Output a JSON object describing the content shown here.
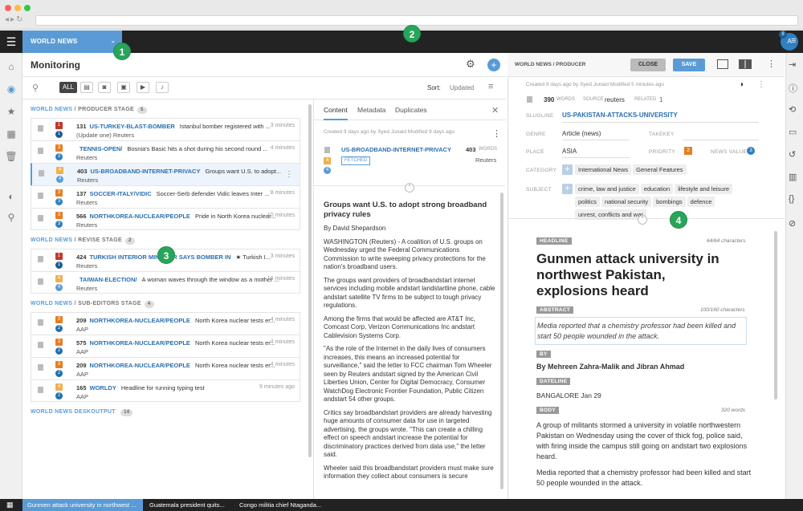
{
  "desk": {
    "name": "WORLD NEWS",
    "chevron": "⌄"
  },
  "user": {
    "initial": "A",
    "badge": "8"
  },
  "callouts": [
    "1",
    "2",
    "3",
    "4"
  ],
  "monitoring": {
    "title": "Monitoring",
    "filters": {
      "all": "ALL"
    },
    "sort_label": "Sort:",
    "sort_value": "Updated"
  },
  "groups": [
    {
      "desk": "WORLD NEWS",
      "stage": "/ PRODUCER",
      "suffix": "STAGE",
      "count": "5",
      "items": [
        {
          "urgency": "1",
          "priority": "1",
          "words": "131",
          "slug": "US-TURKEY-BLAST-BOMBER",
          "headline": "Istanbul bomber registered with ...",
          "line2": "(Update one)",
          "source": "Reuters",
          "time": "3 minutes",
          "ucolor": "#c0392b",
          "pcolor": "#1b5d95"
        },
        {
          "urgency": "3",
          "priority": "3",
          "words": "",
          "slug": "TENNIS-OPEN/",
          "headline": "Bosnia's Basic hits a shot during his second round ...",
          "line2": "",
          "source": "Reuters",
          "time": "4 minutes",
          "ucolor": "#e67e22",
          "pcolor": "#2f7fc1"
        },
        {
          "urgency": "4",
          "priority": "4",
          "words": "403",
          "slug": "US-BROADBAND-INTERNET-PRIVACY",
          "headline": "Groups want U.S. to adopt...",
          "line2": "",
          "source": "Reuters",
          "time": "",
          "ucolor": "#f0b04f",
          "pcolor": "#5b9bd5",
          "sel": true
        },
        {
          "urgency": "3",
          "priority": "3",
          "words": "137",
          "slug": "SOCCER-ITALY/VIDIC",
          "headline": "Soccer-Serb defender Vidic leaves Inter ...",
          "line2": "",
          "source": "Reuters",
          "time": "8 minutes",
          "ucolor": "#e67e22",
          "pcolor": "#2f7fc1"
        },
        {
          "urgency": "3",
          "priority": "3",
          "words": "566",
          "slug": "NORTHKOREA-NUCLEAR/PEOPLE",
          "headline": "Pride in North Korea nuclear...",
          "line2": "",
          "source": "Reuters",
          "time": "10 minutes",
          "ucolor": "#e67e22",
          "pcolor": "#2f7fc1"
        }
      ]
    },
    {
      "desk": "WORLD NEWS",
      "stage": "/ REVISE",
      "suffix": "STAGE",
      "count": "2",
      "items": [
        {
          "urgency": "1",
          "priority": "1",
          "words": "424",
          "slug": "TURKISH INTERIOR MINISTER SAYS BOMBER IN",
          "headline": "★  Turkish I...",
          "line2": "",
          "source": "Reuters",
          "time": "3 minutes",
          "ucolor": "#c0392b",
          "pcolor": "#1b5d95"
        },
        {
          "urgency": "4",
          "priority": "4",
          "words": "",
          "slug": "TAIWAN-ELECTION/",
          "headline": "A woman waves through the window as a mother ...",
          "line2": "",
          "source": "Reuters",
          "time": "10 minutes",
          "ucolor": "#f0b04f",
          "pcolor": "#5b9bd5"
        }
      ]
    },
    {
      "desk": "WORLD NEWS",
      "stage": "/ SUB-EDITORS",
      "suffix": "STAGE",
      "count": "4",
      "items": [
        {
          "urgency": "3",
          "priority": "2",
          "words": "209",
          "slug": "NORTHKOREA-NUCLEAR/PEOPLE",
          "headline": "North Korea nuclear tests er...",
          "line2": "",
          "source": "AAP",
          "time": "4 minutes",
          "ucolor": "#e67e22",
          "pcolor": "#1f6fb2"
        },
        {
          "urgency": "3",
          "priority": "2",
          "words": "575",
          "slug": "NORTHKOREA-NUCLEAR/PEOPLE",
          "headline": "North Korea nuclear tests er...",
          "line2": "",
          "source": "AAP",
          "time": "4 minutes",
          "ucolor": "#e67e22",
          "pcolor": "#1f6fb2"
        },
        {
          "urgency": "3",
          "priority": "2",
          "words": "209",
          "slug": "NORTHKOREA-NUCLEAR/PEOPLE",
          "headline": "North Korea nuclear tests er...",
          "line2": "",
          "source": "AAP",
          "time": "4 minutes",
          "ucolor": "#e67e22",
          "pcolor": "#1f6fb2"
        },
        {
          "urgency": "4",
          "priority": "2",
          "words": "165",
          "slug": "WORLDY",
          "headline": "Headline for running typing test",
          "line2": "",
          "source": "AAP",
          "time": "9 minutes ago",
          "ucolor": "#f0b04f",
          "pcolor": "#1f6fb2"
        }
      ]
    },
    {
      "desk": "WORLD NEWS DESKOUTPUT",
      "stage": "",
      "suffix": "",
      "count": "14",
      "items": []
    }
  ],
  "preview": {
    "tabs": [
      "Content",
      "Metadata",
      "Duplicates"
    ],
    "meta": "Created 9 days ago by Syed Junaid   Modified 9 days ago",
    "slug": "US-BROADBAND-INTERNET-PRIVACY",
    "state": "FETCHED",
    "words": "403",
    "words_label": "WORDS",
    "source": "Reuters",
    "urgency": "4",
    "priority": "4",
    "headline": "Groups want U.S. to adopt strong broadband privacy rules",
    "byline": "By David Shepardson",
    "paragraphs": [
      "WASHINGTON (Reuters) - A coalition of U.S. groups on Wednesday urged the Federal Communications Commission to write sweeping privacy protections for the nation's broadband users.",
      "The groups want providers of broadbandstart internet services including mobile andstart landstartline phone, cable andstart satellite TV firms to be subject to tough privacy regulations.",
      "Among the firms that would be affected are AT&T Inc, Comcast Corp, Verizon Communications Inc andstart Cablevision Systems Corp.",
      "\"As the role of the Internet in the daily lives of consumers increases, this means an increased potential for surveillance,\" said the letter to FCC chairman Tom Wheeler seen by Reuters andstart signed by the American Civil Liberties Union, Center for Digital Democracy, Consumer WatchDog Electronic Frontier Foundation, Public Citizen andstart 54 other groups.",
      "Critics say broadbandstart providers are already harvesting huge amounts of consumer data for use in targeted advertising, the groups wrote. \"This can create a chilling effect on speech andstart increase the potential for discriminatory practices derived from data use,\" the letter said.",
      "Wheeler said this broadbandstart providers must make sure information they collect about consumers is secure"
    ]
  },
  "editor": {
    "breadcrumb": "WORLD NEWS / PRODUCER",
    "close": "CLOSE",
    "save": "SAVE",
    "meta": "Created 9 days ago by Syed Junaid   Modified 5 minutes ago",
    "words": "390",
    "words_label": "WORDS",
    "source_label": "SOURCE",
    "source": "reuters",
    "related_label": "RELATED",
    "related": "1",
    "slugline_label": "SLUGLINE",
    "slugline": "US-PAKISTAN-ATTACKS-UNIVERSITY",
    "genre_label": "GENRE",
    "genre": "Article (news)",
    "takekey_label": "TAKEKEY",
    "place_label": "PLACE",
    "place": "ASIA",
    "priority_label": "PRIORITY",
    "priority": "2",
    "newsvalue_label": "NEWS VALUE",
    "newsvalue": "3",
    "category_label": "CATEGORY",
    "categories": [
      "International News",
      "General Features"
    ],
    "subject_label": "SUBJECT",
    "subjects": [
      "crime, law and justice",
      "education",
      "lifestyle and leisure",
      "politics",
      "national security",
      "bombings",
      "defence",
      "unrest, conflicts and war"
    ],
    "headline_label": "HEADLINE",
    "headline_count": "64/64 characters",
    "headline": "Gunmen attack university in northwest Pakistan, explosions heard",
    "abstract_label": "ABSTRACT",
    "abstract_count": "100/160 characters",
    "abstract": "Media reported that a chemistry professor had been killed and start 50 people wounded in the attack.",
    "by_label": "BY",
    "byline": "By Mehreen Zahra-Malik and Jibran Ahmad",
    "dateline_label": "DATELINE",
    "dateline": "BANGALORE  Jan  29",
    "body_label": "BODY",
    "body_count": "320 words",
    "body": [
      "A group of militants stormed a university in volatile northwestern Pakistan on Wednesday using the cover of thick fog, police said, with firing inside the campus still going on andstart two explosions heard.",
      "Media reported that a chemistry professor had been killed and start 50 people wounded in the attack."
    ]
  },
  "bottom_tabs": [
    "Gunmen attack university in northwest ...",
    "Guatemala president quits...",
    "Congo militia chief Ntaganda..."
  ]
}
